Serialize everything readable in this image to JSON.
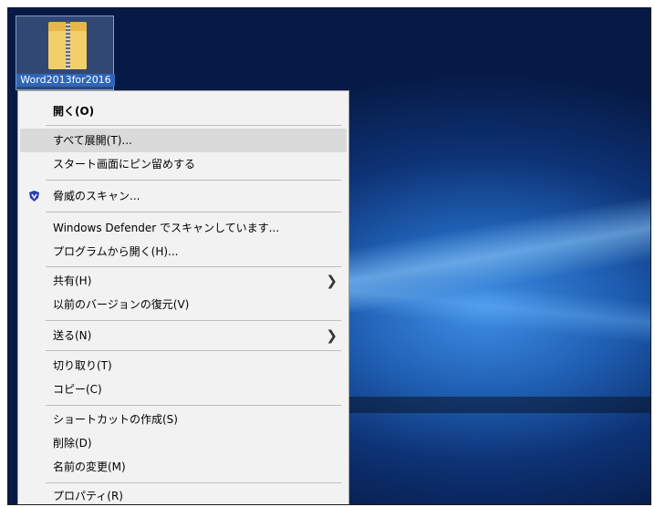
{
  "desktop": {
    "file_label": "Word2013for2016"
  },
  "menu": {
    "open": "開く(O)",
    "extract_all": "すべて展開(T)...",
    "pin_start": "スタート画面にピン留めする",
    "scan_threats": "脅威のスキャン...",
    "defender_scan": "Windows Defender でスキャンしています...",
    "open_with": "プログラムから開く(H)...",
    "share": "共有(H)",
    "restore_versions": "以前のバージョンの復元(V)",
    "send_to": "送る(N)",
    "cut": "切り取り(T)",
    "copy": "コピー(C)",
    "create_shortcut": "ショートカットの作成(S)",
    "delete": "削除(D)",
    "rename": "名前の変更(M)",
    "properties": "プロパティ(R)"
  },
  "icons": {
    "folder": "zip-folder-icon",
    "shield": "shield-icon",
    "submenu": "chevron-right-icon"
  },
  "colors": {
    "menu_bg": "#f2f2f2",
    "highlight": "#dadada",
    "desktop_blue": "#0d3274"
  }
}
